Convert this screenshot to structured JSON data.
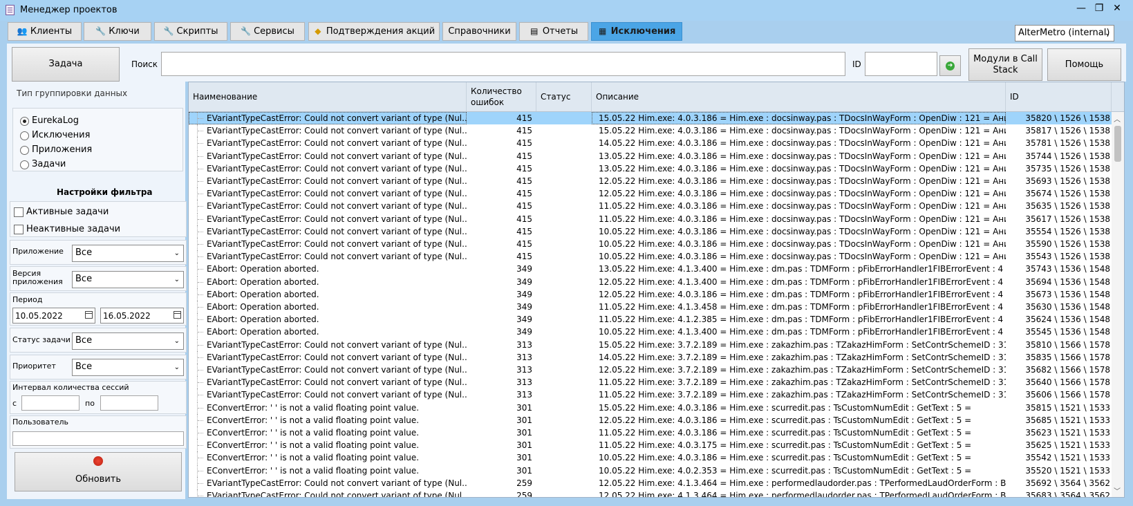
{
  "window": {
    "title": "Менеджер проектов",
    "controls": [
      "—",
      "❐",
      "✕"
    ]
  },
  "tabs": [
    {
      "label": "Клиенты",
      "icon": "users-icon"
    },
    {
      "label": "Ключи",
      "icon": "key-icon"
    },
    {
      "label": "Скрипты",
      "icon": "script-icon"
    },
    {
      "label": "Сервисы",
      "icon": "wrench-icon"
    },
    {
      "label": "Подтверждения акций",
      "icon": "badge-icon"
    },
    {
      "label": "Справочники",
      "icon": ""
    },
    {
      "label": "Отчеты",
      "icon": "report-icon"
    },
    {
      "label": "Исключения",
      "icon": "table-icon",
      "active": true
    }
  ],
  "server_select": {
    "value": "AlterMetro (internal)"
  },
  "toolbar": {
    "task_button": "Задача",
    "search_label": "Поиск",
    "search_value": "",
    "id_label": "ID",
    "id_value": "",
    "modules_button": "Модули в Call Stack",
    "help_button": "Помощь"
  },
  "left": {
    "grouping_title": "Тип группировки данных",
    "grouping_options": [
      "EurekaLog",
      "Исключения",
      "Приложения",
      "Задачи"
    ],
    "grouping_selected": 0,
    "filter_title": "Настройки фильтра",
    "active_tasks": "Активные задачи",
    "inactive_tasks": "Неактивные задачи",
    "app_label": "Приложение",
    "app_value": "Все",
    "version_label": "Версия приложения",
    "version_value": "Все",
    "period_label": "Период",
    "date_from": "10.05.2022",
    "date_to": "16.05.2022",
    "status_label": "Статус задачи",
    "status_value": "Все",
    "priority_label": "Приоритет",
    "priority_value": "Все",
    "sessions_label": "Интервал количества сессий",
    "from_label": "с",
    "to_label": "по",
    "user_label": "Пользователь",
    "refresh_button": "Обновить"
  },
  "grid": {
    "columns": [
      "Наименование",
      "Количество ошибок",
      "Статус",
      "Описание",
      "ID"
    ],
    "selected_row": 0,
    "rows": [
      [
        "EVariantTypeCastError: Could not convert variant of type (Nul...",
        "415",
        "",
        "15.05.22 Him.exe: 4.0.3.186  =  Him.exe : docsinway.pas : TDocsInWayForm : OpenDiw : 121  =  Ани...",
        "35820 \\ 1526 \\ 1538"
      ],
      [
        "EVariantTypeCastError: Could not convert variant of type (Nul...",
        "415",
        "",
        "15.05.22 Him.exe: 4.0.3.186  =  Him.exe : docsinway.pas : TDocsInWayForm : OpenDiw : 121  =  Ани...",
        "35817 \\ 1526 \\ 1538"
      ],
      [
        "EVariantTypeCastError: Could not convert variant of type (Nul...",
        "415",
        "",
        "14.05.22 Him.exe: 4.0.3.186  =  Him.exe : docsinway.pas : TDocsInWayForm : OpenDiw : 121  =  Ани...",
        "35781 \\ 1526 \\ 1538"
      ],
      [
        "EVariantTypeCastError: Could not convert variant of type (Nul...",
        "415",
        "",
        "13.05.22 Him.exe: 4.0.3.186  =  Him.exe : docsinway.pas : TDocsInWayForm : OpenDiw : 121  =  Ани...",
        "35744 \\ 1526 \\ 1538"
      ],
      [
        "EVariantTypeCastError: Could not convert variant of type (Nul...",
        "415",
        "",
        "13.05.22 Him.exe: 4.0.3.186  =  Him.exe : docsinway.pas : TDocsInWayForm : OpenDiw : 121  =  Ани...",
        "35735 \\ 1526 \\ 1538"
      ],
      [
        "EVariantTypeCastError: Could not convert variant of type (Nul...",
        "415",
        "",
        "12.05.22 Him.exe: 4.0.3.186  =  Him.exe : docsinway.pas : TDocsInWayForm : OpenDiw : 121  =  Ани...",
        "35693 \\ 1526 \\ 1538"
      ],
      [
        "EVariantTypeCastError: Could not convert variant of type (Nul...",
        "415",
        "",
        "12.05.22 Him.exe: 4.0.3.186  =  Him.exe : docsinway.pas : TDocsInWayForm : OpenDiw : 121  =  Ани...",
        "35674 \\ 1526 \\ 1538"
      ],
      [
        "EVariantTypeCastError: Could not convert variant of type (Nul...",
        "415",
        "",
        "11.05.22 Him.exe: 4.0.3.186  =  Him.exe : docsinway.pas : TDocsInWayForm : OpenDiw : 121  =  Ани...",
        "35635 \\ 1526 \\ 1538"
      ],
      [
        "EVariantTypeCastError: Could not convert variant of type (Nul...",
        "415",
        "",
        "11.05.22 Him.exe: 4.0.3.186  =  Him.exe : docsinway.pas : TDocsInWayForm : OpenDiw : 121  =  Ани...",
        "35617 \\ 1526 \\ 1538"
      ],
      [
        "EVariantTypeCastError: Could not convert variant of type (Nul...",
        "415",
        "",
        "10.05.22 Him.exe: 4.0.3.186  =  Him.exe : docsinway.pas : TDocsInWayForm : OpenDiw : 121  =  Ани...",
        "35554 \\ 1526 \\ 1538"
      ],
      [
        "EVariantTypeCastError: Could not convert variant of type (Nul...",
        "415",
        "",
        "10.05.22 Him.exe: 4.0.3.186  =  Him.exe : docsinway.pas : TDocsInWayForm : OpenDiw : 121  =  Ани...",
        "35590 \\ 1526 \\ 1538"
      ],
      [
        "EVariantTypeCastError: Could not convert variant of type (Nul...",
        "415",
        "",
        "10.05.22 Him.exe: 4.0.3.186  =  Him.exe : docsinway.pas : TDocsInWayForm : OpenDiw : 121  =  Ани...",
        "35543 \\ 1526 \\ 1538"
      ],
      [
        "EAbort: Operation aborted.",
        "349",
        "",
        "13.05.22 Him.exe: 4.1.3.400  =  Him.exe : dm.pas : TDMForm : pFibErrorHandler1FIBErrorEvent : 4  ...",
        "35743 \\ 1536 \\ 1548"
      ],
      [
        "EAbort: Operation aborted.",
        "349",
        "",
        "12.05.22 Him.exe: 4.1.3.400  =  Him.exe : dm.pas : TDMForm : pFibErrorHandler1FIBErrorEvent : 4  ...",
        "35694 \\ 1536 \\ 1548"
      ],
      [
        "EAbort: Operation aborted.",
        "349",
        "",
        "12.05.22 Him.exe: 4.0.3.186  =  Him.exe : dm.pas : TDMForm : pFibErrorHandler1FIBErrorEvent : 4  ...",
        "35673 \\ 1536 \\ 1548"
      ],
      [
        "EAbort: Operation aborted.",
        "349",
        "",
        "11.05.22 Him.exe: 4.1.3.458  =  Him.exe : dm.pas : TDMForm : pFibErrorHandler1FIBErrorEvent : 4  ...",
        "35630 \\ 1536 \\ 1548"
      ],
      [
        "EAbort: Operation aborted.",
        "349",
        "",
        "11.05.22 Him.exe: 4.1.2.385  =  Him.exe : dm.pas : TDMForm : pFibErrorHandler1FIBErrorEvent : 4  ...",
        "35624 \\ 1536 \\ 1548"
      ],
      [
        "EAbort: Operation aborted.",
        "349",
        "",
        "10.05.22 Him.exe: 4.1.3.400  =  Him.exe : dm.pas : TDMForm : pFibErrorHandler1FIBErrorEvent : 4  ...",
        "35545 \\ 1536 \\ 1548"
      ],
      [
        "EVariantTypeCastError: Could not convert variant of type (Nul...",
        "313",
        "",
        "15.05.22 Him.exe: 3.7.2.189  =  Him.exe : zakazhim.pas : TZakazHimForm : SetContrSchemeID : 31  =",
        "35810 \\ 1566 \\ 1578"
      ],
      [
        "EVariantTypeCastError: Could not convert variant of type (Nul...",
        "313",
        "",
        "14.05.22 Him.exe: 3.7.2.189  =  Him.exe : zakazhim.pas : TZakazHimForm : SetContrSchemeID : 31  =",
        "35835 \\ 1566 \\ 1578"
      ],
      [
        "EVariantTypeCastError: Could not convert variant of type (Nul...",
        "313",
        "",
        "12.05.22 Him.exe: 3.7.2.189  =  Him.exe : zakazhim.pas : TZakazHimForm : SetContrSchemeID : 31  =",
        "35682 \\ 1566 \\ 1578"
      ],
      [
        "EVariantTypeCastError: Could not convert variant of type (Nul...",
        "313",
        "",
        "11.05.22 Him.exe: 3.7.2.189  =  Him.exe : zakazhim.pas : TZakazHimForm : SetContrSchemeID : 31  =",
        "35640 \\ 1566 \\ 1578"
      ],
      [
        "EVariantTypeCastError: Could not convert variant of type (Nul...",
        "313",
        "",
        "11.05.22 Him.exe: 3.7.2.189  =  Him.exe : zakazhim.pas : TZakazHimForm : SetContrSchemeID : 31  =",
        "35606 \\ 1566 \\ 1578"
      ],
      [
        "EConvertError: ' ' is not a valid floating point value.",
        "301",
        "",
        "15.05.22 Him.exe: 4.0.3.186  =  Him.exe : scurredit.pas : TsCustomNumEdit : GetText : 5  =",
        "35815 \\ 1521 \\ 1533"
      ],
      [
        "EConvertError: ' ' is not a valid floating point value.",
        "301",
        "",
        "12.05.22 Him.exe: 4.0.3.186  =  Him.exe : scurredit.pas : TsCustomNumEdit : GetText : 5  =",
        "35685 \\ 1521 \\ 1533"
      ],
      [
        "EConvertError: ' ' is not a valid floating point value.",
        "301",
        "",
        "11.05.22 Him.exe: 4.0.3.186  =  Him.exe : scurredit.pas : TsCustomNumEdit : GetText : 5  =",
        "35623 \\ 1521 \\ 1533"
      ],
      [
        "EConvertError: ' ' is not a valid floating point value.",
        "301",
        "",
        "11.05.22 Him.exe: 4.0.3.175  =  Him.exe : scurredit.pas : TsCustomNumEdit : GetText : 5  =",
        "35625 \\ 1521 \\ 1533"
      ],
      [
        "EConvertError: ' ' is not a valid floating point value.",
        "301",
        "",
        "10.05.22 Him.exe: 4.0.3.186  =  Him.exe : scurredit.pas : TsCustomNumEdit : GetText : 5  =",
        "35542 \\ 1521 \\ 1533"
      ],
      [
        "EConvertError: ' ' is not a valid floating point value.",
        "301",
        "",
        "10.05.22 Him.exe: 4.0.2.353  =  Him.exe : scurredit.pas : TsCustomNumEdit : GetText : 5  =",
        "35520 \\ 1521 \\ 1533"
      ],
      [
        "EVariantTypeCastError: Could not convert variant of type (Nul...",
        "259",
        "",
        "12.05.22 Him.exe: 4.1.3.464  =  Him.exe : performedlaudorder.pas : TPerformedLaudOrderForm : B...",
        "35692 \\ 3564 \\ 3562"
      ],
      [
        "EVariantTypeCastError: Could not convert variant of type (Nul...",
        "259",
        "",
        "12.05.22 Him.exe: 4.1.3.464  =  Him.exe : performedlaudorder.pas : TPerformedLaudOrderForm : B...",
        "35683 \\ 3564 \\ 3562"
      ]
    ]
  },
  "colors": {
    "active_tab": "#4ba5e6",
    "selected_row": "#9fd4fb",
    "titlebar": "#a7d2f3"
  }
}
